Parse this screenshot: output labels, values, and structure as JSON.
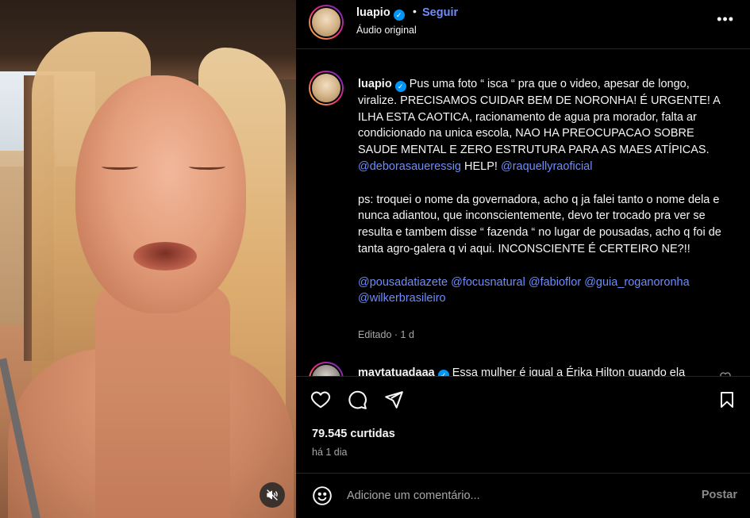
{
  "post": {
    "author": "luapio",
    "follow_label": "Seguir",
    "separator": "•",
    "audio_label": "Áudio original",
    "more_label": "•••"
  },
  "caption": {
    "user": "luapio",
    "text_part1": "Pus uma foto “ isca “ pra que o video, apesar de longo, viralize. PRECISAMOS CUIDAR BEM DE NORONHA! É URGENTE! A ILHA ESTA CAOTICA, racionamento de agua pra morador, falta ar condicionado na unica escola, NAO HA PREOCUPACAO SOBRE SAUDE MENTAL E ZERO ESTRUTURA PARA AS MAES ATÍPICAS.",
    "mention1": "@deborasaueressig",
    "help": "HELP!",
    "mention2": "@raquellyraoficial",
    "text_part2": "ps: troquei o nome da governadora, acho q ja falei tanto o nome dela e nunca adiantou, que inconscientemente, devo ter trocado pra ver se resulta e tambem disse “ fazenda “ no lugar de pousadas, acho q foi de tanta agro-galera q vi aqui. INCONSCIENTE É CERTEIRO NE?!!",
    "tag1": "@pousadatiazete",
    "tag2": "@focusnatural",
    "tag3": "@fabioflor",
    "tag4": "@guia_roganoronha",
    "tag5": "@wilkerbrasileiro",
    "edited": "Editado",
    "edited_sep": "·",
    "edited_age": "1 d"
  },
  "next_comment": {
    "user": "maytatuadaaa",
    "text": "Essa mulher é igual a Érika Hilton quando ela"
  },
  "stats": {
    "likes": "79.545 curtidas",
    "posted": "há 1 dia"
  },
  "comment_box": {
    "placeholder": "Adicione um comentário...",
    "post_label": "Postar"
  },
  "colors": {
    "accent": "#6e8cfb",
    "verified": "#0095f6",
    "background": "#000000"
  }
}
